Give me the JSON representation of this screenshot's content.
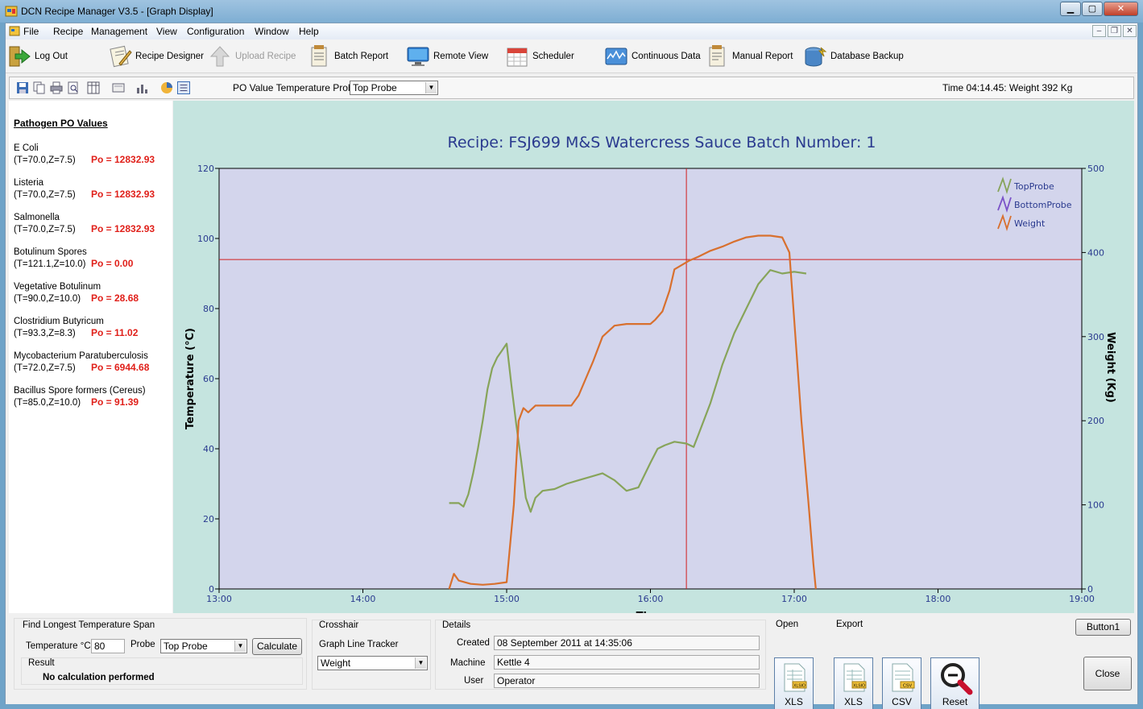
{
  "window": {
    "title": "DCN Recipe Manager V3.5 - [Graph Display]"
  },
  "menu": [
    "File",
    "Recipe",
    "Management",
    "View",
    "Configuration",
    "Window",
    "Help"
  ],
  "toolbar": {
    "logout": "Log Out",
    "recipe_designer": "Recipe Designer",
    "upload_recipe": "Upload Recipe",
    "batch_report": "Batch Report",
    "remote_view": "Remote View",
    "scheduler": "Scheduler",
    "continuous_data": "Continuous Data",
    "manual_report": "Manual Report",
    "database_backup": "Database Backup"
  },
  "secondary_toolbar": {
    "po_label": "PO Value Temperature Probe",
    "po_probe_value": "Top Probe",
    "status": "Time 04:14.45: Weight 392 Kg"
  },
  "pathogens": {
    "heading": "Pathogen PO Values",
    "items": [
      {
        "name": "E Coli",
        "params": "(T=70.0,Z=7.5)",
        "po": "Po = 12832.93"
      },
      {
        "name": "Listeria",
        "params": "(T=70.0,Z=7.5)",
        "po": "Po = 12832.93"
      },
      {
        "name": "Salmonella",
        "params": "(T=70.0,Z=7.5)",
        "po": "Po = 12832.93"
      },
      {
        "name": "Botulinum Spores",
        "params": "(T=121.1,Z=10.0)",
        "po": "Po = 0.00"
      },
      {
        "name": "Vegetative Botulinum",
        "params": "(T=90.0,Z=10.0)",
        "po": "Po = 28.68"
      },
      {
        "name": "Clostridium Butyricum",
        "params": "(T=93.3,Z=8.3)",
        "po": "Po = 11.02"
      },
      {
        "name": "Mycobacterium Paratuberculosis",
        "params": "(T=72.0,Z=7.5)",
        "po": "Po = 6944.68"
      },
      {
        "name": "Bacillus Spore formers (Cereus)",
        "params": "(T=85.0,Z=10.0)",
        "po": "Po = 91.39"
      }
    ]
  },
  "chart_data": {
    "type": "line",
    "title": "Recipe:  FSJ699 M&S Watercress Sauce   Batch Number:  1",
    "xlabel": "Time",
    "ylabel": "Temperature  (°C)",
    "y2label": "Weight  (Kg)",
    "x_ticks": [
      "13:00",
      "14:00",
      "15:00",
      "16:00",
      "17:00",
      "18:00",
      "19:00"
    ],
    "xlim": [
      "13:00",
      "19:00"
    ],
    "ylim": [
      0,
      120
    ],
    "y_ticks": [
      0,
      20,
      40,
      60,
      80,
      100,
      120
    ],
    "y2lim": [
      0,
      500
    ],
    "y2_ticks": [
      0,
      100,
      200,
      300,
      400,
      500
    ],
    "legend_position": "top-right",
    "grid": false,
    "crosshair": {
      "x": "16:15",
      "y": 94
    },
    "series": [
      {
        "name": "TopProbe",
        "axis": "left",
        "color": "#87a45a",
        "points": [
          [
            "14:36",
            24.5
          ],
          [
            "14:40",
            24.5
          ],
          [
            "14:42",
            23.5
          ],
          [
            "14:44",
            27
          ],
          [
            "14:46",
            33
          ],
          [
            "14:48",
            40
          ],
          [
            "14:50",
            48
          ],
          [
            "14:52",
            57
          ],
          [
            "14:54",
            63
          ],
          [
            "14:56",
            66
          ],
          [
            "14:58",
            68
          ],
          [
            "15:00",
            70
          ],
          [
            "15:02",
            58
          ],
          [
            "15:04",
            47
          ],
          [
            "15:06",
            37
          ],
          [
            "15:08",
            26
          ],
          [
            "15:10",
            22
          ],
          [
            "15:12",
            26
          ],
          [
            "15:15",
            28
          ],
          [
            "15:20",
            28.5
          ],
          [
            "15:25",
            30
          ],
          [
            "15:30",
            31
          ],
          [
            "15:35",
            32
          ],
          [
            "15:40",
            33
          ],
          [
            "15:45",
            31
          ],
          [
            "15:50",
            28
          ],
          [
            "15:55",
            29
          ],
          [
            "16:00",
            36
          ],
          [
            "16:03",
            40
          ],
          [
            "16:06",
            41
          ],
          [
            "16:10",
            42
          ],
          [
            "16:15",
            41.5
          ],
          [
            "16:18",
            40.5
          ],
          [
            "16:20",
            44
          ],
          [
            "16:25",
            53
          ],
          [
            "16:30",
            64
          ],
          [
            "16:35",
            73
          ],
          [
            "16:40",
            80
          ],
          [
            "16:45",
            87
          ],
          [
            "16:50",
            91
          ],
          [
            "16:55",
            90
          ],
          [
            "17:00",
            90.5
          ],
          [
            "17:05",
            90
          ]
        ]
      },
      {
        "name": "BottomProbe",
        "axis": "left",
        "color": "#7a52c8",
        "points": []
      },
      {
        "name": "Weight",
        "axis": "right",
        "color": "#d8702e",
        "points": [
          [
            "14:36",
            0
          ],
          [
            "14:38",
            18
          ],
          [
            "14:40",
            10
          ],
          [
            "14:45",
            6
          ],
          [
            "14:50",
            5
          ],
          [
            "14:55",
            6
          ],
          [
            "15:00",
            8
          ],
          [
            "15:03",
            100
          ],
          [
            "15:05",
            200
          ],
          [
            "15:07",
            215
          ],
          [
            "15:09",
            210
          ],
          [
            "15:12",
            218
          ],
          [
            "15:15",
            218
          ],
          [
            "15:20",
            218
          ],
          [
            "15:25",
            218
          ],
          [
            "15:27",
            218
          ],
          [
            "15:30",
            230
          ],
          [
            "15:33",
            250
          ],
          [
            "15:36",
            270
          ],
          [
            "15:40",
            300
          ],
          [
            "15:45",
            313
          ],
          [
            "15:50",
            315
          ],
          [
            "15:55",
            315
          ],
          [
            "16:00",
            315
          ],
          [
            "16:02",
            320
          ],
          [
            "16:05",
            330
          ],
          [
            "16:08",
            355
          ],
          [
            "16:10",
            380
          ],
          [
            "16:13",
            385
          ],
          [
            "16:16",
            390
          ],
          [
            "16:20",
            395
          ],
          [
            "16:25",
            402
          ],
          [
            "16:30",
            407
          ],
          [
            "16:35",
            413
          ],
          [
            "16:40",
            418
          ],
          [
            "16:45",
            420
          ],
          [
            "16:50",
            420
          ],
          [
            "16:55",
            418
          ],
          [
            "16:58",
            400
          ],
          [
            "17:00",
            320
          ],
          [
            "17:03",
            200
          ],
          [
            "17:06",
            100
          ],
          [
            "17:08",
            30
          ],
          [
            "17:09",
            0
          ]
        ]
      }
    ]
  },
  "bottom": {
    "span": {
      "label": "Find Longest Temperature Span",
      "temp_label": "Temperature °C",
      "temp_value": "80",
      "probe_label": "Probe",
      "probe_value": "Top Probe",
      "calculate": "Calculate",
      "result_label": "Result",
      "result_text": "No calculation performed"
    },
    "crosshair": {
      "label": "Crosshair",
      "tracker_label": "Graph Line Tracker",
      "tracker_value": "Weight"
    },
    "details": {
      "label": "Details",
      "created_label": "Created",
      "created_value": "08 September 2011 at 14:35:06",
      "machine_label": "Machine",
      "machine_value": "Kettle 4",
      "user_label": "User",
      "user_value": "Operator"
    },
    "open": {
      "label": "Open",
      "xls": "XLS"
    },
    "export": {
      "label": "Export",
      "xls": "XLS",
      "csv": "CSV",
      "reset": "Reset"
    },
    "button1": "Button1",
    "close": "Close"
  }
}
